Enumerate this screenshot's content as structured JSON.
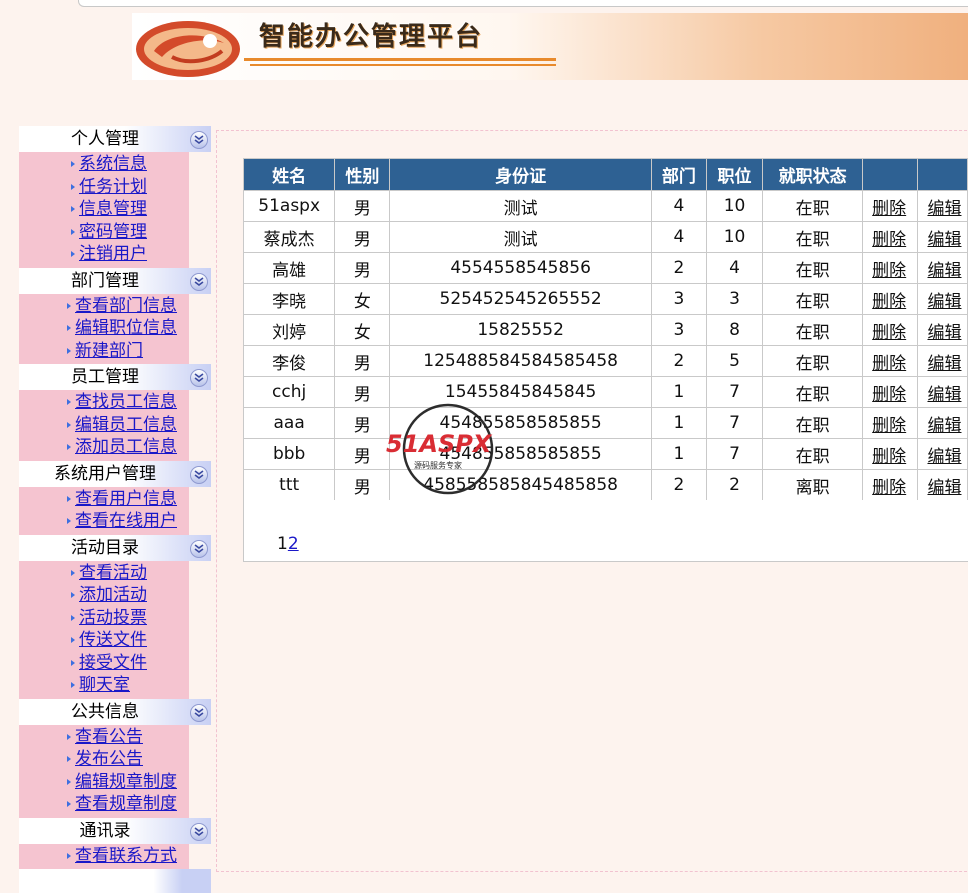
{
  "header": {
    "title": "智能办公管理平台"
  },
  "sidebar": {
    "sections": [
      {
        "title": "个人管理",
        "items": [
          "系统信息",
          "任务计划",
          "信息管理",
          "密码管理",
          "注销用户"
        ]
      },
      {
        "title": "部门管理",
        "items": [
          "查看部门信息",
          "编辑职位信息",
          "新建部门"
        ]
      },
      {
        "title": "员工管理",
        "items": [
          "查找员工信息",
          "编辑员工信息",
          "添加员工信息"
        ]
      },
      {
        "title": "系统用户管理",
        "items": [
          "查看用户信息",
          "查看在线用户"
        ]
      },
      {
        "title": "活动目录",
        "items": [
          "查看活动",
          "添加活动",
          "活动投票",
          "传送文件",
          "接受文件",
          "聊天室"
        ]
      },
      {
        "title": "公共信息",
        "items": [
          "查看公告",
          "发布公告",
          "编辑规章制度",
          "查看规章制度"
        ]
      },
      {
        "title": "通讯录",
        "items": [
          "查看联系方式"
        ]
      }
    ]
  },
  "table": {
    "columns": [
      "姓名",
      "性别",
      "身份证",
      "部门",
      "职位",
      "就职状态",
      "",
      ""
    ],
    "delete_label": "删除",
    "edit_label": "编辑",
    "rows": [
      [
        "51aspx",
        "男",
        "测试",
        "4",
        "10",
        "在职"
      ],
      [
        "蔡成杰",
        "男",
        "测试",
        "4",
        "10",
        "在职"
      ],
      [
        "高雄",
        "男",
        "4554558545856",
        "2",
        "4",
        "在职"
      ],
      [
        "李晓",
        "女",
        "525452545265552",
        "3",
        "3",
        "在职"
      ],
      [
        "刘婷",
        "女",
        "15825552",
        "3",
        "8",
        "在职"
      ],
      [
        "李俊",
        "男",
        "125488584584585458",
        "2",
        "5",
        "在职"
      ],
      [
        "cchj",
        "男",
        "15455845845845",
        "1",
        "7",
        "在职"
      ],
      [
        "aaa",
        "男",
        "454855858585855",
        "1",
        "7",
        "在职"
      ],
      [
        "bbb",
        "男",
        "454855858585855",
        "1",
        "7",
        "在职"
      ],
      [
        "ttt",
        "男",
        "458558585845485858",
        "2",
        "2",
        "离职"
      ]
    ]
  },
  "pager": {
    "current": "1",
    "next": "2"
  },
  "watermark": {
    "brand": "51ASPX",
    "tagline": "源码服务专家"
  },
  "colors": {
    "page_bg": "#fdf3ee",
    "table_header": "#2e6193",
    "sidebar_items_bg": "#f5c4d0",
    "link": "#1a18c8"
  }
}
